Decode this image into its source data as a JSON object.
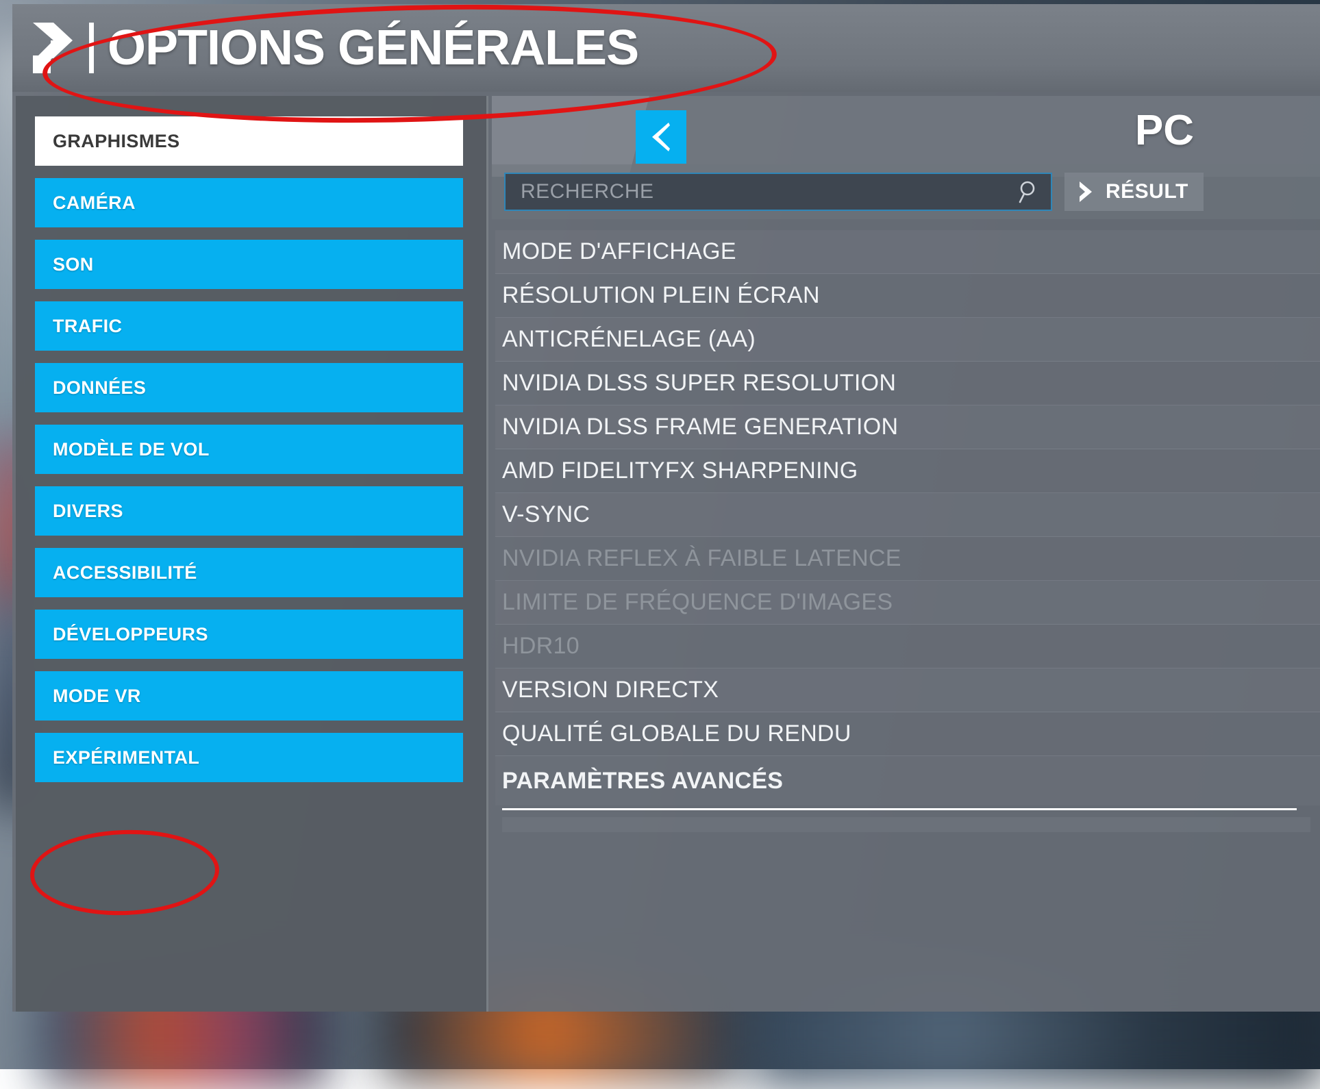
{
  "header": {
    "title": "OPTIONS GÉNÉRALES",
    "logo_icon": "flight-sim-chevron-logo"
  },
  "sidebar": {
    "items": [
      {
        "label": "GRAPHISMES",
        "selected": true
      },
      {
        "label": "CAMÉRA",
        "selected": false
      },
      {
        "label": "SON",
        "selected": false
      },
      {
        "label": "TRAFIC",
        "selected": false
      },
      {
        "label": "DONNÉES",
        "selected": false
      },
      {
        "label": "MODÈLE DE VOL",
        "selected": false
      },
      {
        "label": "DIVERS",
        "selected": false
      },
      {
        "label": "ACCESSIBILITÉ",
        "selected": false
      },
      {
        "label": "DÉVELOPPEURS",
        "selected": false
      },
      {
        "label": "MODE VR",
        "selected": false
      },
      {
        "label": "EXPÉRIMENTAL",
        "selected": false
      }
    ]
  },
  "content": {
    "back_button_icon": "chevron-left-icon",
    "platform_label": "PC",
    "search": {
      "placeholder": "RECHERCHE",
      "value": "",
      "icon": "search-icon"
    },
    "results_button": {
      "label": "RÉSULT",
      "icon": "chevron-right-icon"
    },
    "settings": [
      {
        "label": "MODE D'AFFICHAGE",
        "disabled": false,
        "section": false
      },
      {
        "label": "RÉSOLUTION PLEIN ÉCRAN",
        "disabled": false,
        "section": false
      },
      {
        "label": "ANTICRÉNELAGE (AA)",
        "disabled": false,
        "section": false
      },
      {
        "label": "NVIDIA DLSS SUPER RESOLUTION",
        "disabled": false,
        "section": false
      },
      {
        "label": "NVIDIA DLSS FRAME GENERATION",
        "disabled": false,
        "section": false
      },
      {
        "label": "AMD FIDELITYFX SHARPENING",
        "disabled": false,
        "section": false
      },
      {
        "label": "V-SYNC",
        "disabled": false,
        "section": false
      },
      {
        "label": "NVIDIA REFLEX À FAIBLE LATENCE",
        "disabled": true,
        "section": false
      },
      {
        "label": "LIMITE DE FRÉQUENCE D'IMAGES",
        "disabled": true,
        "section": false
      },
      {
        "label": "HDR10",
        "disabled": true,
        "section": false
      },
      {
        "label": "VERSION DIRECTX",
        "disabled": false,
        "section": false
      },
      {
        "label": "QUALITÉ GLOBALE DU RENDU",
        "disabled": false,
        "section": false
      },
      {
        "label": "PARAMÈTRES AVANCÉS",
        "disabled": false,
        "section": true
      }
    ]
  },
  "annotations": [
    {
      "name": "title-ellipse",
      "shape": "ellipse",
      "color": "#e01414",
      "targets": "OPTIONS GÉNÉRALES"
    },
    {
      "name": "experimental-ellipse",
      "shape": "ellipse",
      "color": "#e01414",
      "targets": "EXPÉRIMENTAL"
    }
  ],
  "colors": {
    "accent_blue": "#06b0f0",
    "panel_gray": "#6e747c",
    "sidebar_gray": "#565b62",
    "selected_white": "#ffffff",
    "disabled_text": "#8f959c",
    "annotation_red": "#e01414"
  }
}
